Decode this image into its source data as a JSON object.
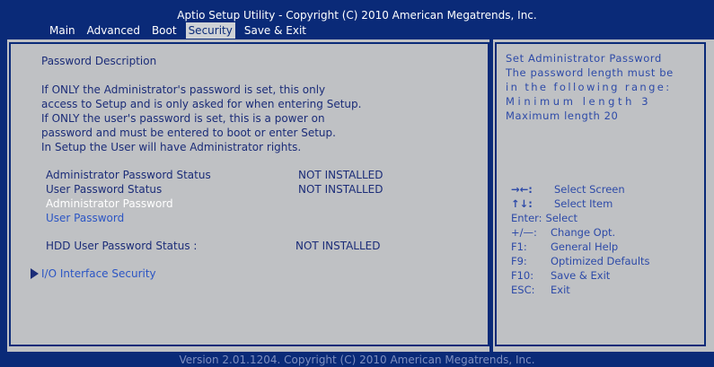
{
  "header": {
    "title": "Aptio Setup Utility - Copyright (C) 2010 American Megatrends, Inc.",
    "tabs": [
      {
        "label": "Main",
        "active": false
      },
      {
        "label": "Advanced",
        "active": false
      },
      {
        "label": "Boot",
        "active": false
      },
      {
        "label": "Security",
        "active": true
      },
      {
        "label": "Save & Exit",
        "active": false
      }
    ]
  },
  "left": {
    "section_title": "Password Description",
    "description": [
      "If ONLY the Administrator's password is set, this only",
      "access to Setup and is only asked for when entering Setup.",
      "If ONLY the user's password is set, this is a power on",
      "password and must be entered to boot or enter Setup.",
      "In Setup the User will have Administrator rights."
    ],
    "admin_status_label": "Administrator Password Status",
    "admin_status_value": "NOT INSTALLED",
    "user_status_label": "User Password Status",
    "user_status_value": "NOT INSTALLED",
    "admin_password_item": "Administrator Password",
    "user_password_item": "User Password",
    "hdd_status_label": "HDD User Password Status :",
    "hdd_status_value": "NOT INSTALLED",
    "io_item": "I/O Interface Security"
  },
  "help": {
    "lines": [
      "Set Administrator Password",
      "The password length must be",
      "in the following range:",
      "Minimum length 3",
      "Maximum length 20"
    ]
  },
  "keys": [
    {
      "key": "",
      "action": "Select Screen",
      "icon": "left-right-arrows-icon"
    },
    {
      "key": "",
      "action": "Select Item",
      "icon": "up-down-arrows-icon"
    },
    {
      "key": "Enter:",
      "action": "Select"
    },
    {
      "key": "+/—:",
      "action": "Change Opt."
    },
    {
      "key": "F1:",
      "action": "General Help"
    },
    {
      "key": "F9:",
      "action": "Optimized Defaults"
    },
    {
      "key": "F10:",
      "action": "Save & Exit"
    },
    {
      "key": "ESC:",
      "action": "Exit"
    }
  ],
  "footer": "Version 2.01.1204. Copyright (C) 2010 American Megatrends, Inc.",
  "colors": {
    "background_blue": "#0a2a78",
    "panel_gray": "#bfc1c4",
    "text_blue": "#1b2c78",
    "highlight_white": "#ffffff",
    "link_blue": "#2b55c4",
    "help_blue": "#2d4aa8"
  }
}
